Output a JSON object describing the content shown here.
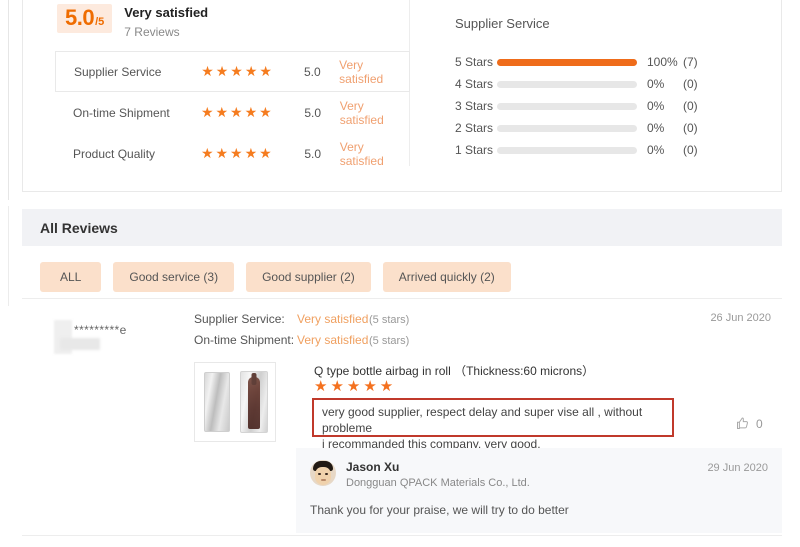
{
  "summary": {
    "score": "5.0",
    "score_suffix": "/5",
    "title": "Very satisfied",
    "review_count": "7 Reviews",
    "rows": [
      {
        "label": "Supplier Service",
        "stars": "★★★★★",
        "score": "5.0",
        "text": "Very satisfied",
        "selected": true
      },
      {
        "label": "On-time Shipment",
        "stars": "★★★★★",
        "score": "5.0",
        "text": "Very satisfied",
        "selected": false
      },
      {
        "label": "Product Quality",
        "stars": "★★★★★",
        "score": "5.0",
        "text": "Very satisfied",
        "selected": false
      }
    ]
  },
  "distribution": {
    "title": "Supplier Service",
    "rows": [
      {
        "label": "5 Stars",
        "percent": "100%",
        "count": "(7)",
        "value": 100
      },
      {
        "label": "4 Stars",
        "percent": "0%",
        "count": "(0)",
        "value": 0
      },
      {
        "label": "3 Stars",
        "percent": "0%",
        "count": "(0)",
        "value": 0
      },
      {
        "label": "2 Stars",
        "percent": "0%",
        "count": "(0)",
        "value": 0
      },
      {
        "label": "1 Stars",
        "percent": "0%",
        "count": "(0)",
        "value": 0
      }
    ]
  },
  "all_reviews": {
    "header": "All Reviews",
    "filters": [
      {
        "label": "ALL"
      },
      {
        "label": "Good service (3)"
      },
      {
        "label": "Good supplier (2)"
      },
      {
        "label": "Arrived quickly (2)"
      }
    ]
  },
  "review": {
    "reviewer_name": "*********e",
    "date": "26 Jun 2020",
    "ratings": [
      {
        "label": "Supplier Service:",
        "value": "Very satisfied",
        "stars_note": "(5 stars)"
      },
      {
        "label": "On-time Shipment:",
        "value": "Very satisfied",
        "stars_note": "(5 stars)"
      }
    ],
    "product_title": "Q type bottle airbag in roll （Thickness:60 microns）",
    "product_stars": "★★★★★",
    "body_lines": [
      "very good supplier, respect delay and super vise all , without probleme",
      "i recommanded this company, very good,"
    ],
    "like_count": "0",
    "like_icon": "thumbs-up-icon",
    "reply": {
      "name": "Jason Xu",
      "company": "Dongguan QPACK Materials Co., Ltd.",
      "date": "29 Jun 2020",
      "text": "Thank you for your praise, we will try to do better"
    }
  },
  "colors": {
    "accent": "#ef6c1a",
    "chip_bg": "#fbe0cb",
    "highlight_border": "#c0392b"
  }
}
